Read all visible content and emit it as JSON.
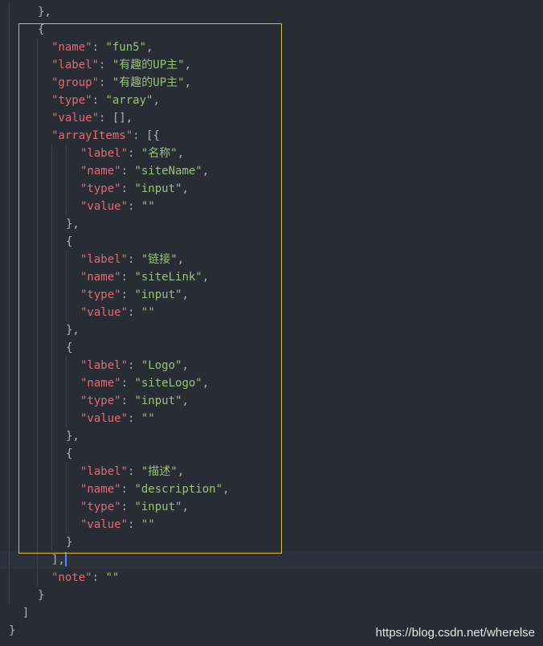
{
  "editor": {
    "lines": [
      {
        "indent": 1,
        "parts": [
          {
            "t": "},",
            "c": "p"
          }
        ]
      },
      {
        "indent": 1,
        "parts": [
          {
            "t": "{",
            "c": "p"
          }
        ]
      },
      {
        "indent": 2,
        "parts": [
          {
            "t": "\"name\"",
            "c": "k"
          },
          {
            "t": ": ",
            "c": "p"
          },
          {
            "t": "\"fun5\"",
            "c": "s"
          },
          {
            "t": ",",
            "c": "p"
          }
        ]
      },
      {
        "indent": 2,
        "parts": [
          {
            "t": "\"label\"",
            "c": "k"
          },
          {
            "t": ": ",
            "c": "p"
          },
          {
            "t": "\"有趣的UP主\"",
            "c": "s"
          },
          {
            "t": ",",
            "c": "p"
          }
        ]
      },
      {
        "indent": 2,
        "parts": [
          {
            "t": "\"group\"",
            "c": "k"
          },
          {
            "t": ": ",
            "c": "p"
          },
          {
            "t": "\"有趣的UP主\"",
            "c": "s"
          },
          {
            "t": ",",
            "c": "p"
          }
        ]
      },
      {
        "indent": 2,
        "parts": [
          {
            "t": "\"type\"",
            "c": "k"
          },
          {
            "t": ": ",
            "c": "p"
          },
          {
            "t": "\"array\"",
            "c": "s"
          },
          {
            "t": ",",
            "c": "p"
          }
        ]
      },
      {
        "indent": 2,
        "parts": [
          {
            "t": "\"value\"",
            "c": "k"
          },
          {
            "t": ": [],",
            "c": "p"
          }
        ]
      },
      {
        "indent": 2,
        "parts": [
          {
            "t": "\"arrayItems\"",
            "c": "k"
          },
          {
            "t": ": [{",
            "c": "p"
          }
        ]
      },
      {
        "indent": 4,
        "parts": [
          {
            "t": "\"label\"",
            "c": "k"
          },
          {
            "t": ": ",
            "c": "p"
          },
          {
            "t": "\"名称\"",
            "c": "s"
          },
          {
            "t": ",",
            "c": "p"
          }
        ]
      },
      {
        "indent": 4,
        "parts": [
          {
            "t": "\"name\"",
            "c": "k"
          },
          {
            "t": ": ",
            "c": "p"
          },
          {
            "t": "\"siteName\"",
            "c": "s"
          },
          {
            "t": ",",
            "c": "p"
          }
        ]
      },
      {
        "indent": 4,
        "parts": [
          {
            "t": "\"type\"",
            "c": "k"
          },
          {
            "t": ": ",
            "c": "p"
          },
          {
            "t": "\"input\"",
            "c": "s"
          },
          {
            "t": ",",
            "c": "p"
          }
        ]
      },
      {
        "indent": 4,
        "parts": [
          {
            "t": "\"value\"",
            "c": "k"
          },
          {
            "t": ": ",
            "c": "p"
          },
          {
            "t": "\"\"",
            "c": "s"
          }
        ]
      },
      {
        "indent": 3,
        "parts": [
          {
            "t": "},",
            "c": "p"
          }
        ]
      },
      {
        "indent": 3,
        "parts": [
          {
            "t": "{",
            "c": "p"
          }
        ]
      },
      {
        "indent": 4,
        "parts": [
          {
            "t": "\"label\"",
            "c": "k"
          },
          {
            "t": ": ",
            "c": "p"
          },
          {
            "t": "\"链接\"",
            "c": "s"
          },
          {
            "t": ",",
            "c": "p"
          }
        ]
      },
      {
        "indent": 4,
        "parts": [
          {
            "t": "\"name\"",
            "c": "k"
          },
          {
            "t": ": ",
            "c": "p"
          },
          {
            "t": "\"siteLink\"",
            "c": "s"
          },
          {
            "t": ",",
            "c": "p"
          }
        ]
      },
      {
        "indent": 4,
        "parts": [
          {
            "t": "\"type\"",
            "c": "k"
          },
          {
            "t": ": ",
            "c": "p"
          },
          {
            "t": "\"input\"",
            "c": "s"
          },
          {
            "t": ",",
            "c": "p"
          }
        ]
      },
      {
        "indent": 4,
        "parts": [
          {
            "t": "\"value\"",
            "c": "k"
          },
          {
            "t": ": ",
            "c": "p"
          },
          {
            "t": "\"\"",
            "c": "s"
          }
        ]
      },
      {
        "indent": 3,
        "parts": [
          {
            "t": "},",
            "c": "p"
          }
        ]
      },
      {
        "indent": 3,
        "parts": [
          {
            "t": "{",
            "c": "p"
          }
        ]
      },
      {
        "indent": 4,
        "parts": [
          {
            "t": "\"label\"",
            "c": "k"
          },
          {
            "t": ": ",
            "c": "p"
          },
          {
            "t": "\"Logo\"",
            "c": "s"
          },
          {
            "t": ",",
            "c": "p"
          }
        ]
      },
      {
        "indent": 4,
        "parts": [
          {
            "t": "\"name\"",
            "c": "k"
          },
          {
            "t": ": ",
            "c": "p"
          },
          {
            "t": "\"siteLogo\"",
            "c": "s"
          },
          {
            "t": ",",
            "c": "p"
          }
        ]
      },
      {
        "indent": 4,
        "parts": [
          {
            "t": "\"type\"",
            "c": "k"
          },
          {
            "t": ": ",
            "c": "p"
          },
          {
            "t": "\"input\"",
            "c": "s"
          },
          {
            "t": ",",
            "c": "p"
          }
        ]
      },
      {
        "indent": 4,
        "parts": [
          {
            "t": "\"value\"",
            "c": "k"
          },
          {
            "t": ": ",
            "c": "p"
          },
          {
            "t": "\"\"",
            "c": "s"
          }
        ]
      },
      {
        "indent": 3,
        "parts": [
          {
            "t": "},",
            "c": "p"
          }
        ]
      },
      {
        "indent": 3,
        "parts": [
          {
            "t": "{",
            "c": "p"
          }
        ]
      },
      {
        "indent": 4,
        "parts": [
          {
            "t": "\"label\"",
            "c": "k"
          },
          {
            "t": ": ",
            "c": "p"
          },
          {
            "t": "\"描述\"",
            "c": "s"
          },
          {
            "t": ",",
            "c": "p"
          }
        ]
      },
      {
        "indent": 4,
        "parts": [
          {
            "t": "\"name\"",
            "c": "k"
          },
          {
            "t": ": ",
            "c": "p"
          },
          {
            "t": "\"description\"",
            "c": "s"
          },
          {
            "t": ",",
            "c": "p"
          }
        ]
      },
      {
        "indent": 4,
        "parts": [
          {
            "t": "\"type\"",
            "c": "k"
          },
          {
            "t": ": ",
            "c": "p"
          },
          {
            "t": "\"input\"",
            "c": "s"
          },
          {
            "t": ",",
            "c": "p"
          }
        ]
      },
      {
        "indent": 4,
        "parts": [
          {
            "t": "\"value\"",
            "c": "k"
          },
          {
            "t": ": ",
            "c": "p"
          },
          {
            "t": "\"\"",
            "c": "s"
          }
        ]
      },
      {
        "indent": 3,
        "parts": [
          {
            "t": "}",
            "c": "p"
          }
        ]
      },
      {
        "indent": 2,
        "parts": [
          {
            "t": "],",
            "c": "p"
          }
        ],
        "cursor": true
      },
      {
        "indent": 2,
        "parts": [
          {
            "t": "\"note\"",
            "c": "k"
          },
          {
            "t": ": ",
            "c": "p"
          },
          {
            "t": "\"\"",
            "c": "s"
          }
        ]
      },
      {
        "indent": 1,
        "parts": [
          {
            "t": "}",
            "c": "p"
          }
        ]
      },
      {
        "indent": 0,
        "parts": [
          {
            "t": "  ]",
            "c": "p"
          }
        ]
      },
      {
        "indent": 0,
        "parts": [
          {
            "t": "}",
            "c": "p"
          }
        ]
      }
    ]
  },
  "watermark": "https://blog.csdn.net/wherelse",
  "colors": {
    "background": "#282c34",
    "key": "#e06c75",
    "string": "#98c379",
    "punctuation": "#abb2bf",
    "highlight_border": "#d7ba41",
    "cursor": "#528bff"
  }
}
